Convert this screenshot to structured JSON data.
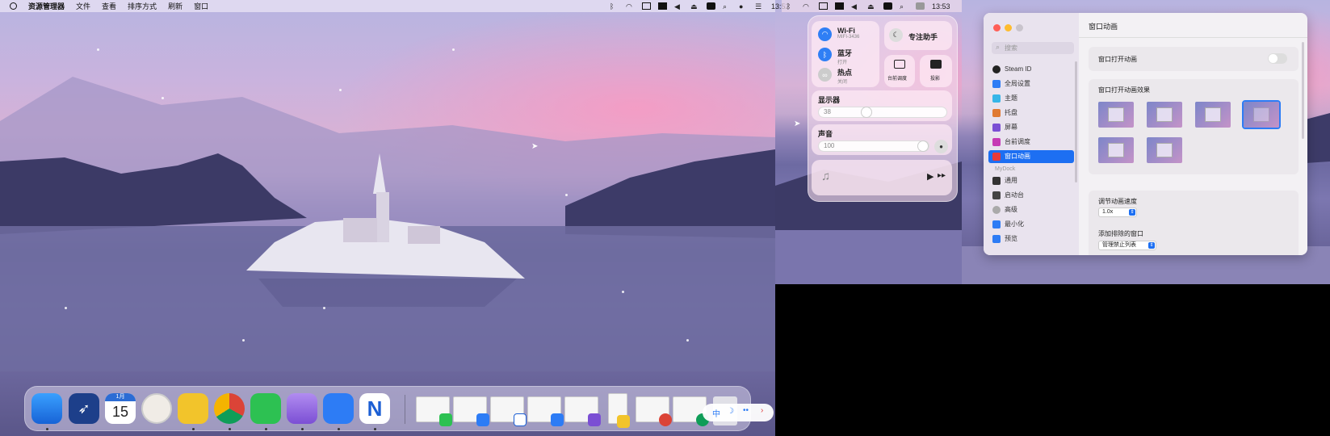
{
  "menubar": {
    "app": "资源管理器",
    "menus": [
      "文件",
      "查看",
      "排序方式",
      "刷新",
      "窗口"
    ],
    "time_left": "13:52",
    "time_right": "13:53"
  },
  "control_center": {
    "wifi": {
      "title": "Wi-Fi",
      "sub": "MIFI-3436"
    },
    "bluetooth": {
      "title": "蓝牙",
      "sub": "打开"
    },
    "hotspot": {
      "title": "热点",
      "sub": "关闭"
    },
    "focus": "专注助手",
    "stage": "台前调度",
    "mirror": "投影",
    "display": {
      "label": "显示器",
      "value": "38",
      "fraction": 0.38
    },
    "sound": {
      "label": "声音",
      "value": "100",
      "fraction": 1.0
    }
  },
  "settings": {
    "title": "窗口动画",
    "search_placeholder": "搜索",
    "sidebar": [
      "Steam ID",
      "全局设置",
      "主题",
      "托盘",
      "屏幕",
      "台前调度",
      "窗口动画"
    ],
    "group_label": "MyDock",
    "sidebar2": [
      "通用",
      "启动台",
      "高级",
      "最小化",
      "预览"
    ],
    "open_anim_label": "窗口打开动画",
    "effect_label": "窗口打开动画效果",
    "speed_label": "调节动画速度",
    "speed_value": "1.0x",
    "exclude_label": "添加排除的窗口",
    "exclude_button": "管理禁止列表"
  },
  "dock": {
    "calendar_month": "1月",
    "calendar_day": "15",
    "ime_char": "中"
  },
  "colors": {
    "accent": "#1d6ff2"
  }
}
